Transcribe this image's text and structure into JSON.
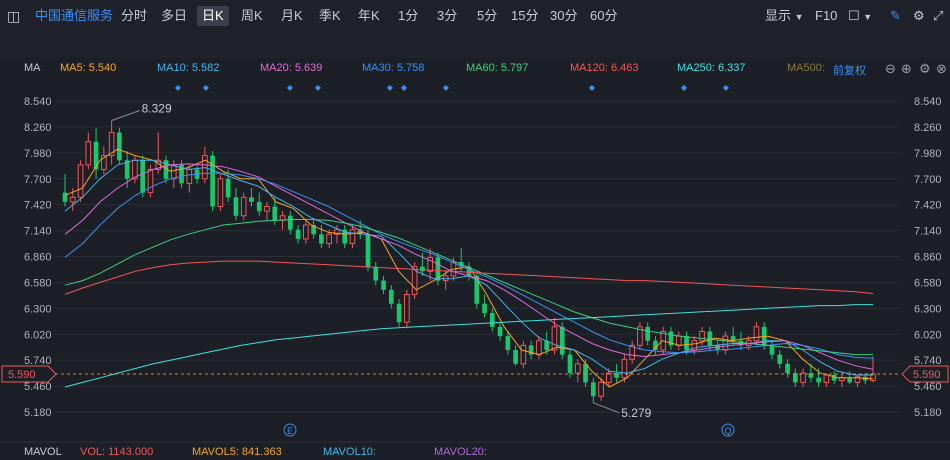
{
  "toolbar": {
    "symbol": "中国通信服务",
    "periods": [
      "分时",
      "多日",
      "日K",
      "周K",
      "月K",
      "季K",
      "年K",
      "1分",
      "3分",
      "5分",
      "15分",
      "30分",
      "60分"
    ],
    "active_period": "日K",
    "display": "显示",
    "f10": "F10",
    "text_tool": "Aa"
  },
  "indicators": {
    "label": "MA",
    "items": [
      {
        "label": "MA5: 5.540",
        "color": "#f5a623"
      },
      {
        "label": "MA10: 5.582",
        "color": "#47b5e8"
      },
      {
        "label": "MA20: 5.639",
        "color": "#e06ad8"
      },
      {
        "label": "MA30: 5.758",
        "color": "#3d8ff5"
      },
      {
        "label": "MA60: 5.797",
        "color": "#3bcf7e"
      },
      {
        "label": "MA120: 6.463",
        "color": "#f0575a"
      },
      {
        "label": "MA250: 6.337",
        "color": "#42e0e0"
      },
      {
        "label": "MA500:",
        "color": "#8a7a3e"
      }
    ],
    "adjust": "前复权"
  },
  "volume": {
    "label": "MAVOL",
    "items": [
      {
        "label": "VOL: 1143.000",
        "color": "#f0575a"
      },
      {
        "label": "MAVOL5: 841.363",
        "color": "#f5a623"
      },
      {
        "label": "MAVOL10:",
        "color": "#47b5e8"
      },
      {
        "label": "MAVOL20:",
        "color": "#b06ad8"
      }
    ]
  },
  "chart_data": {
    "type": "candlestick",
    "y_ticks": [
      "8.540",
      "8.260",
      "7.980",
      "7.700",
      "7.420",
      "7.140",
      "6.860",
      "6.580",
      "6.300",
      "6.020",
      "5.740",
      "5.460",
      "5.180"
    ],
    "ylim": [
      5.18,
      8.54
    ],
    "current_price": "5.590",
    "annotations": {
      "high": "8.329",
      "low": "5.279"
    },
    "event_markers": [
      "E",
      "Q"
    ],
    "up_color": "#f0575a",
    "down_color": "#18c86b",
    "ma_lines": [
      {
        "name": "MA5",
        "color": "#f5a623"
      },
      {
        "name": "MA10",
        "color": "#47b5e8"
      },
      {
        "name": "MA20",
        "color": "#e06ad8"
      },
      {
        "name": "MA30",
        "color": "#3d8ff5"
      },
      {
        "name": "MA60",
        "color": "#3bcf7e"
      },
      {
        "name": "MA120",
        "color": "#f0575a"
      },
      {
        "name": "MA250",
        "color": "#42e0e0"
      }
    ],
    "candles": [
      [
        7.55,
        7.75,
        7.4,
        7.45
      ],
      [
        7.45,
        7.6,
        7.35,
        7.5
      ],
      [
        7.5,
        7.9,
        7.45,
        7.85
      ],
      [
        7.85,
        8.2,
        7.8,
        8.1
      ],
      [
        8.1,
        8.25,
        7.7,
        7.8
      ],
      [
        7.8,
        8.05,
        7.75,
        7.95
      ],
      [
        7.95,
        8.329,
        7.85,
        8.2
      ],
      [
        8.2,
        8.25,
        7.85,
        7.9
      ],
      [
        7.9,
        8.0,
        7.6,
        7.7
      ],
      [
        7.7,
        7.95,
        7.65,
        7.9
      ],
      [
        7.9,
        7.95,
        7.5,
        7.55
      ],
      [
        7.55,
        7.85,
        7.5,
        7.8
      ],
      [
        7.8,
        8.2,
        7.75,
        7.9
      ],
      [
        7.9,
        7.95,
        7.65,
        7.7
      ],
      [
        7.7,
        7.9,
        7.6,
        7.85
      ],
      [
        7.85,
        7.9,
        7.6,
        7.65
      ],
      [
        7.65,
        7.85,
        7.55,
        7.8
      ],
      [
        7.8,
        7.85,
        7.65,
        7.7
      ],
      [
        7.7,
        8.05,
        7.65,
        7.95
      ],
      [
        7.95,
        8.0,
        7.35,
        7.4
      ],
      [
        7.4,
        7.75,
        7.35,
        7.7
      ],
      [
        7.7,
        7.8,
        7.45,
        7.5
      ],
      [
        7.5,
        7.6,
        7.25,
        7.3
      ],
      [
        7.3,
        7.55,
        7.25,
        7.5
      ],
      [
        7.5,
        7.6,
        7.4,
        7.45
      ],
      [
        7.45,
        7.55,
        7.3,
        7.35
      ],
      [
        7.35,
        7.45,
        7.25,
        7.4
      ],
      [
        7.4,
        7.5,
        7.2,
        7.25
      ],
      [
        7.25,
        7.35,
        7.15,
        7.3
      ],
      [
        7.3,
        7.35,
        7.1,
        7.15
      ],
      [
        7.15,
        7.2,
        7.0,
        7.05
      ],
      [
        7.05,
        7.25,
        7.0,
        7.2
      ],
      [
        7.2,
        7.25,
        7.05,
        7.1
      ],
      [
        7.1,
        7.2,
        6.95,
        7.0
      ],
      [
        7.0,
        7.15,
        6.95,
        7.1
      ],
      [
        7.1,
        7.2,
        7.0,
        7.15
      ],
      [
        7.15,
        7.2,
        6.95,
        7.0
      ],
      [
        7.0,
        7.2,
        6.95,
        7.15
      ],
      [
        7.15,
        7.25,
        7.05,
        7.1
      ],
      [
        7.1,
        7.15,
        6.7,
        6.75
      ],
      [
        6.75,
        6.8,
        6.55,
        6.6
      ],
      [
        6.6,
        6.65,
        6.45,
        6.5
      ],
      [
        6.5,
        6.55,
        6.3,
        6.35
      ],
      [
        6.35,
        6.4,
        6.1,
        6.15
      ],
      [
        6.15,
        6.5,
        6.1,
        6.45
      ],
      [
        6.45,
        6.8,
        6.4,
        6.75
      ],
      [
        6.75,
        6.9,
        6.65,
        6.7
      ],
      [
        6.7,
        6.95,
        6.6,
        6.85
      ],
      [
        6.85,
        6.9,
        6.55,
        6.6
      ],
      [
        6.6,
        6.7,
        6.5,
        6.65
      ],
      [
        6.65,
        6.85,
        6.6,
        6.8
      ],
      [
        6.8,
        6.95,
        6.7,
        6.75
      ],
      [
        6.75,
        6.8,
        6.6,
        6.65
      ],
      [
        6.65,
        6.7,
        6.3,
        6.35
      ],
      [
        6.35,
        6.45,
        6.2,
        6.25
      ],
      [
        6.25,
        6.3,
        6.05,
        6.1
      ],
      [
        6.1,
        6.15,
        5.95,
        6.0
      ],
      [
        6.0,
        6.05,
        5.8,
        5.85
      ],
      [
        5.85,
        5.9,
        5.68,
        5.7
      ],
      [
        5.7,
        5.95,
        5.65,
        5.9
      ],
      [
        5.9,
        5.95,
        5.75,
        5.8
      ],
      [
        5.8,
        6.0,
        5.75,
        5.95
      ],
      [
        5.95,
        6.05,
        5.8,
        5.85
      ],
      [
        5.85,
        6.2,
        5.8,
        6.1
      ],
      [
        6.1,
        6.15,
        5.75,
        5.8
      ],
      [
        5.8,
        5.85,
        5.55,
        5.6
      ],
      [
        5.6,
        5.75,
        5.5,
        5.7
      ],
      [
        5.7,
        5.75,
        5.45,
        5.5
      ],
      [
        5.5,
        5.55,
        5.279,
        5.35
      ],
      [
        5.35,
        5.55,
        5.3,
        5.5
      ],
      [
        5.5,
        5.65,
        5.45,
        5.6
      ],
      [
        5.6,
        5.7,
        5.5,
        5.55
      ],
      [
        5.55,
        5.8,
        5.5,
        5.75
      ],
      [
        5.75,
        5.95,
        5.7,
        5.9
      ],
      [
        5.9,
        6.15,
        5.85,
        6.1
      ],
      [
        6.1,
        6.15,
        5.9,
        5.95
      ],
      [
        5.95,
        6.0,
        5.8,
        5.85
      ],
      [
        5.85,
        6.1,
        5.8,
        6.05
      ],
      [
        6.05,
        6.1,
        5.85,
        5.9
      ],
      [
        5.9,
        6.05,
        5.85,
        6.0
      ],
      [
        6.0,
        6.05,
        5.8,
        5.85
      ],
      [
        5.85,
        6.0,
        5.8,
        5.95
      ],
      [
        5.95,
        6.1,
        5.9,
        6.05
      ],
      [
        6.05,
        6.1,
        5.85,
        5.9
      ],
      [
        5.9,
        5.95,
        5.8,
        5.85
      ],
      [
        5.85,
        6.05,
        5.8,
        6.0
      ],
      [
        6.0,
        6.1,
        5.9,
        5.95
      ],
      [
        5.95,
        6.05,
        5.85,
        5.9
      ],
      [
        5.9,
        6.0,
        5.85,
        5.95
      ],
      [
        5.95,
        6.15,
        5.9,
        6.1
      ],
      [
        6.1,
        6.15,
        5.85,
        5.9
      ],
      [
        5.9,
        5.95,
        5.75,
        5.8
      ],
      [
        5.8,
        5.85,
        5.65,
        5.7
      ],
      [
        5.7,
        5.75,
        5.55,
        5.6
      ],
      [
        5.6,
        5.65,
        5.45,
        5.5
      ],
      [
        5.5,
        5.65,
        5.45,
        5.6
      ],
      [
        5.6,
        5.7,
        5.5,
        5.55
      ],
      [
        5.55,
        5.65,
        5.45,
        5.5
      ],
      [
        5.5,
        5.6,
        5.45,
        5.58
      ],
      [
        5.58,
        5.62,
        5.48,
        5.52
      ],
      [
        5.52,
        5.6,
        5.45,
        5.55
      ],
      [
        5.55,
        5.62,
        5.48,
        5.5
      ],
      [
        5.5,
        5.58,
        5.45,
        5.56
      ],
      [
        5.56,
        5.6,
        5.48,
        5.52
      ],
      [
        5.52,
        5.78,
        5.5,
        5.59
      ]
    ],
    "ma_values": {
      "MA5": [
        7.52,
        7.6,
        7.9,
        8.02,
        7.95,
        7.9,
        7.78,
        7.82,
        7.9,
        7.78,
        7.7,
        7.7,
        7.45,
        7.38,
        7.2,
        7.12,
        7.1,
        7.12,
        7.05,
        6.7,
        6.5,
        6.6,
        6.72,
        6.75,
        6.45,
        6.1,
        5.85,
        5.8,
        5.88,
        5.85,
        5.62,
        5.45,
        5.55,
        5.75,
        5.95,
        5.9,
        5.92,
        5.98,
        5.95,
        5.98,
        6.0,
        5.95,
        5.75,
        5.6,
        5.55,
        5.55,
        5.54
      ],
      "MA10": [
        7.35,
        7.5,
        7.7,
        7.85,
        7.9,
        7.9,
        7.85,
        7.8,
        7.82,
        7.75,
        7.68,
        7.62,
        7.5,
        7.4,
        7.28,
        7.2,
        7.12,
        7.1,
        7.08,
        6.9,
        6.7,
        6.62,
        6.62,
        6.65,
        6.55,
        6.35,
        6.15,
        5.98,
        5.9,
        5.85,
        5.75,
        5.62,
        5.6,
        5.65,
        5.75,
        5.82,
        5.88,
        5.9,
        5.92,
        5.92,
        5.95,
        5.95,
        5.85,
        5.72,
        5.62,
        5.58,
        5.58
      ],
      "MA20": [
        7.1,
        7.25,
        7.45,
        7.6,
        7.72,
        7.8,
        7.85,
        7.86,
        7.85,
        7.83,
        7.78,
        7.72,
        7.62,
        7.52,
        7.42,
        7.32,
        7.22,
        7.12,
        7.05,
        6.98,
        6.88,
        6.8,
        6.7,
        6.65,
        6.6,
        6.5,
        6.38,
        6.25,
        6.12,
        6.02,
        5.92,
        5.85,
        5.8,
        5.78,
        5.8,
        5.82,
        5.85,
        5.88,
        5.9,
        5.92,
        5.94,
        5.95,
        5.9,
        5.82,
        5.74,
        5.68,
        5.64
      ],
      "MA30": [
        6.85,
        7.0,
        7.2,
        7.38,
        7.52,
        7.62,
        7.7,
        7.74,
        7.76,
        7.76,
        7.74,
        7.7,
        7.64,
        7.56,
        7.48,
        7.4,
        7.3,
        7.2,
        7.1,
        7.02,
        6.95,
        6.88,
        6.8,
        6.72,
        6.64,
        6.55,
        6.45,
        6.35,
        6.25,
        6.15,
        6.05,
        5.96,
        5.9,
        5.85,
        5.83,
        5.82,
        5.83,
        5.85,
        5.86,
        5.88,
        5.9,
        5.92,
        5.9,
        5.86,
        5.8,
        5.77,
        5.76
      ],
      "MA60": [
        6.55,
        6.6,
        6.68,
        6.78,
        6.88,
        6.96,
        7.04,
        7.1,
        7.15,
        7.2,
        7.22,
        7.24,
        7.25,
        7.26,
        7.26,
        7.25,
        7.22,
        7.18,
        7.12,
        7.06,
        6.98,
        6.9,
        6.82,
        6.74,
        6.66,
        6.58,
        6.5,
        6.42,
        6.34,
        6.26,
        6.2,
        6.14,
        6.1,
        6.06,
        6.03,
        6.0,
        5.98,
        5.96,
        5.94,
        5.92,
        5.9,
        5.88,
        5.86,
        5.84,
        5.82,
        5.8,
        5.8
      ],
      "MA120": [
        6.45,
        6.52,
        6.58,
        6.64,
        6.7,
        6.74,
        6.77,
        6.79,
        6.8,
        6.81,
        6.81,
        6.81,
        6.8,
        6.79,
        6.78,
        6.77,
        6.76,
        6.75,
        6.74,
        6.73,
        6.72,
        6.71,
        6.7,
        6.69,
        6.68,
        6.67,
        6.66,
        6.65,
        6.64,
        6.63,
        6.62,
        6.61,
        6.6,
        6.6,
        6.59,
        6.58,
        6.57,
        6.56,
        6.55,
        6.54,
        6.53,
        6.52,
        6.51,
        6.5,
        6.49,
        6.48,
        6.46
      ],
      "MA250": [
        5.45,
        5.5,
        5.55,
        5.6,
        5.65,
        5.7,
        5.74,
        5.78,
        5.82,
        5.86,
        5.9,
        5.93,
        5.96,
        5.98,
        6.0,
        6.02,
        6.04,
        6.06,
        6.08,
        6.09,
        6.1,
        6.11,
        6.12,
        6.13,
        6.14,
        6.15,
        6.16,
        6.17,
        6.18,
        6.19,
        6.2,
        6.21,
        6.22,
        6.23,
        6.24,
        6.25,
        6.26,
        6.27,
        6.28,
        6.29,
        6.3,
        6.31,
        6.32,
        6.33,
        6.33,
        6.34,
        6.34
      ]
    }
  }
}
